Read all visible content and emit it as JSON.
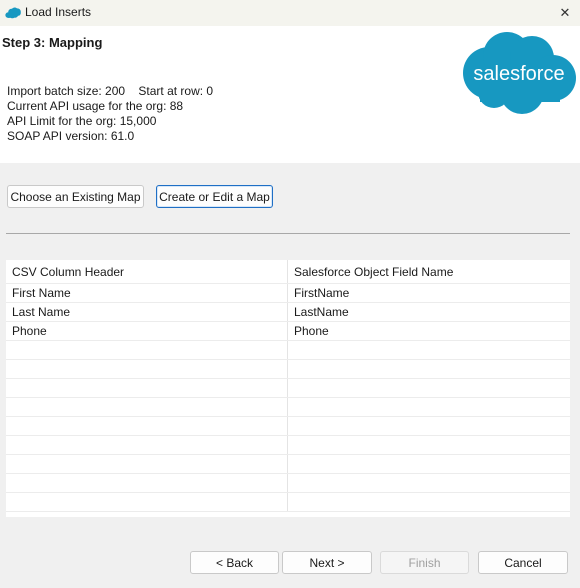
{
  "window": {
    "title": "Load Inserts",
    "close_glyph": "✕"
  },
  "colors": {
    "salesforce_blue": "#1798c1",
    "title_bar": "#f4f4ee",
    "focus_border": "#1f6fc5"
  },
  "header": {
    "step_title": "Step 3: Mapping",
    "batch_line": "Import batch size: 200    Start at row: 0",
    "api_usage": "Current API usage for the org: 88",
    "api_limit": "API Limit for the org: 15,000",
    "soap_version": "SOAP API version: 61.0",
    "logo_text": "salesforce"
  },
  "map_buttons": {
    "existing": "Choose an Existing Map",
    "create": "Create or Edit a Map"
  },
  "mapping_table": {
    "columns": [
      "CSV Column Header",
      "Salesforce Object Field Name"
    ],
    "rows": [
      [
        "First Name",
        "FirstName"
      ],
      [
        "Last Name",
        "LastName"
      ],
      [
        "Phone",
        "Phone"
      ]
    ]
  },
  "footer": {
    "back": "< Back",
    "next": "Next >",
    "finish": "Finish",
    "cancel": "Cancel"
  }
}
